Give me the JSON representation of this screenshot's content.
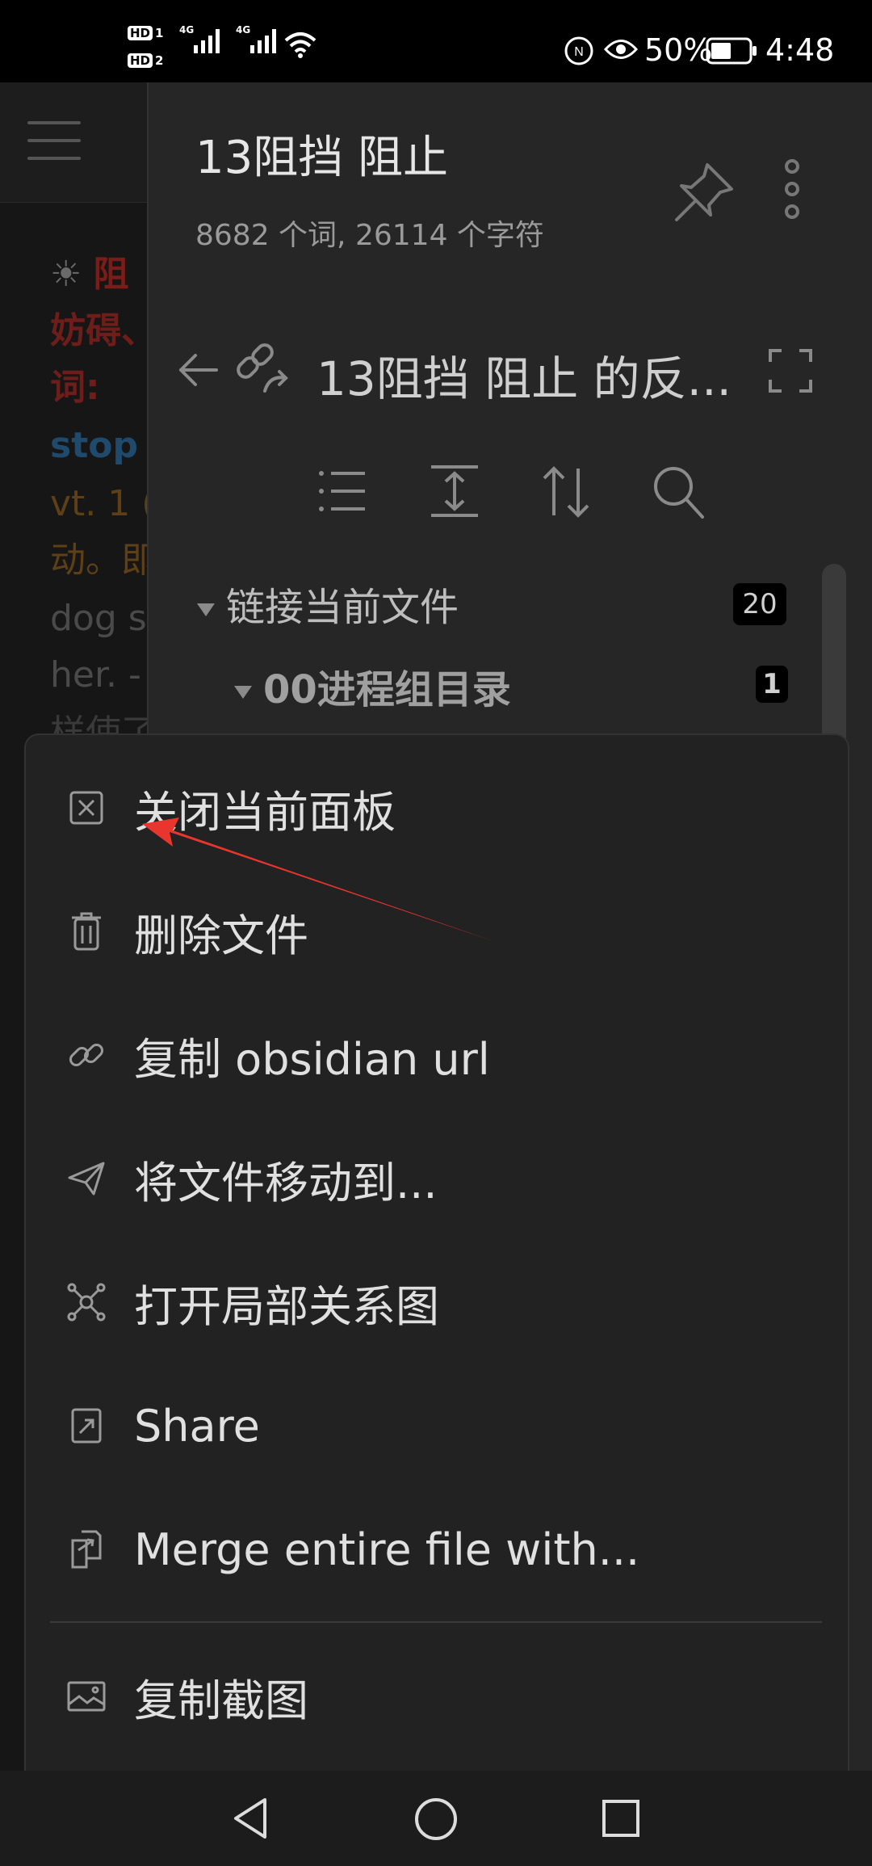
{
  "status_bar": {
    "hd1": "HD",
    "hd1_num": "1",
    "hd2": "HD",
    "hd2_num": "2",
    "net1": "4G",
    "net2": "4G",
    "battery": "50%",
    "time": "4:48"
  },
  "background_editor": {
    "line1_prefix": "☀",
    "line1_red": "阻",
    "line2": "妨碍、",
    "line3": "词:",
    "line4": "stop",
    "line5": "vt. 1 (",
    "line6": "动。即",
    "line7": "dog s",
    "line8": "her. -",
    "line9": "样使了"
  },
  "sidebar": {
    "title": "13阻挡 阻止",
    "subtitle": "8682 个词, 26114 个字符",
    "nav_title": "13阻挡 阻止 的反...",
    "tree": [
      {
        "label": "链接当前文件",
        "count": "20"
      },
      {
        "label": "00进程组目录",
        "count": "1"
      }
    ]
  },
  "menu": {
    "items": [
      {
        "label": "关闭当前面板",
        "icon": "close-square-icon"
      },
      {
        "label": "删除文件",
        "icon": "trash-icon"
      },
      {
        "label": "复制 obsidian url",
        "icon": "link-icon"
      },
      {
        "label": "将文件移动到...",
        "icon": "send-icon"
      },
      {
        "label": "打开局部关系图",
        "icon": "graph-icon"
      },
      {
        "label": "Share",
        "icon": "share-icon"
      },
      {
        "label": "Merge entire file with...",
        "icon": "merge-file-icon"
      },
      {
        "label": "复制截图",
        "icon": "image-icon"
      }
    ]
  },
  "colors": {
    "accent_red": "#e8362e",
    "text_blue": "#2a6b9a",
    "text_brown": "#8a5a1e"
  }
}
